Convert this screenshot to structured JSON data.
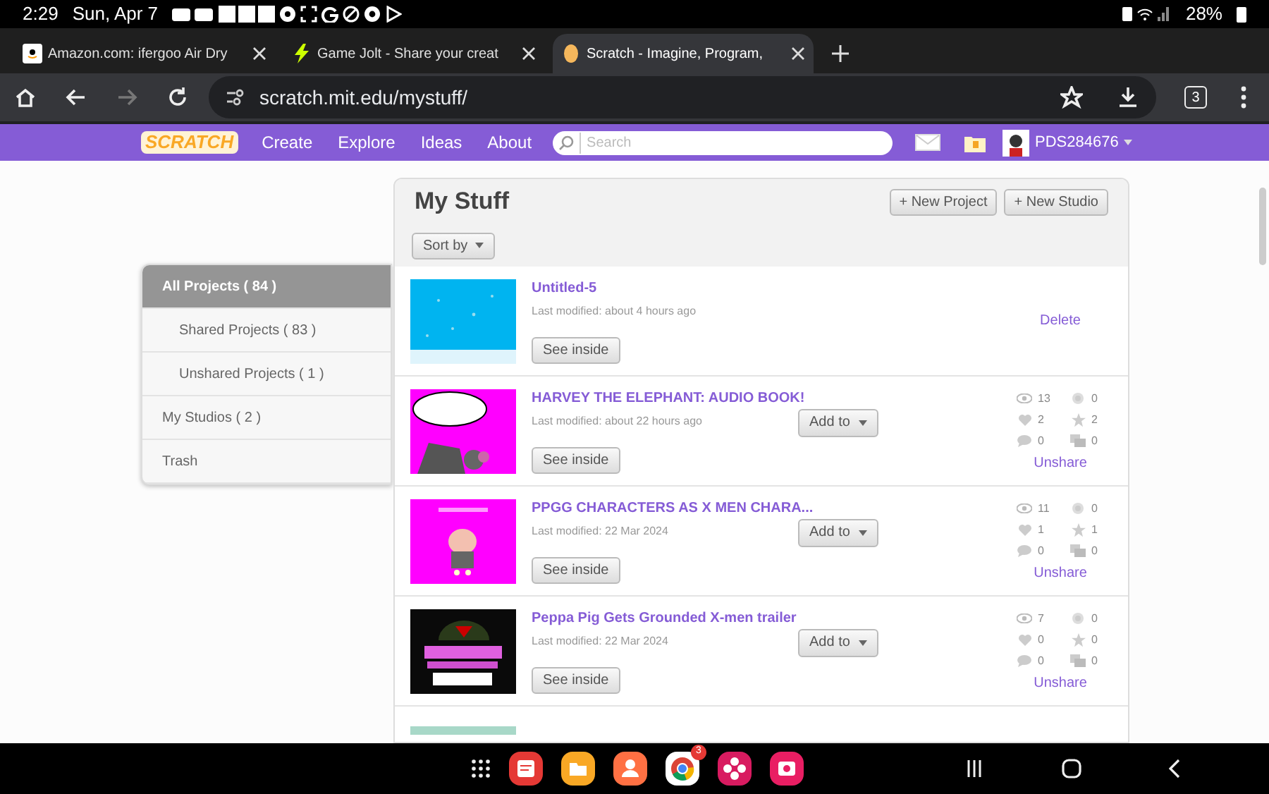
{
  "status_bar": {
    "time": "2:29",
    "date": "Sun, Apr 7",
    "battery": "28%"
  },
  "browser_tabs": [
    {
      "title": "Amazon.com: ifergoo Air Dry",
      "selected": false
    },
    {
      "title": "Game Jolt - Share your creat",
      "selected": false
    },
    {
      "title": "Scratch - Imagine, Program,",
      "selected": true
    }
  ],
  "address_bar": {
    "url": "scratch.mit.edu/mystuff/",
    "tab_count": "3"
  },
  "site_nav": {
    "logo": "SCRATCH",
    "links": [
      "Create",
      "Explore",
      "Ideas",
      "About"
    ],
    "search": {
      "placeholder": "Search"
    },
    "username": "PDS284676"
  },
  "sidebar": {
    "items": [
      {
        "label": "All Projects ( 84 )",
        "selected": true,
        "children": [
          {
            "label": "Shared Projects ( 83 )",
            "selected": false
          },
          {
            "label": "Unshared Projects ( 1 )",
            "selected": false
          }
        ]
      },
      {
        "label": "My Studios ( 2 )",
        "selected": false
      },
      {
        "label": "Trash",
        "selected": false
      }
    ]
  },
  "panel": {
    "title": "My Stuff",
    "buttons": [
      "+ New Project",
      "+ New Studio"
    ],
    "sort": "Sort by"
  },
  "projects": [
    {
      "title": "Untitled-5",
      "modified": "Last modified: about 4 hours ago",
      "see_inside": "See inside",
      "link": "Delete"
    },
    {
      "title": "HARVEY THE ELEPHANT: AUDIO BOOK!",
      "modified": "Last modified: about 22 hours ago",
      "see_inside": "See inside",
      "add_to": "Add to",
      "stats": {
        "views": "13",
        "loves": "2",
        "comments": "0",
        "remixes": "0",
        "favorites": "2",
        "studios": "0"
      },
      "link": "Unshare"
    },
    {
      "title": "PPGG CHARACTERS AS X MEN CHARA...",
      "modified": "Last modified: 22 Mar 2024",
      "see_inside": "See inside",
      "add_to": "Add to",
      "stats": {
        "views": "11",
        "loves": "1",
        "comments": "0",
        "remixes": "0",
        "favorites": "1",
        "studios": "0"
      },
      "link": "Unshare"
    },
    {
      "title": "Peppa Pig Gets Grounded X-men trailer",
      "modified": "Last modified: 22 Mar 2024",
      "see_inside": "See inside",
      "add_to": "Add to",
      "stats": {
        "views": "7",
        "loves": "0",
        "comments": "0",
        "remixes": "0",
        "favorites": "0",
        "studios": "0"
      },
      "link": "Unshare"
    }
  ],
  "dock": {
    "chrome_badge": "3"
  }
}
